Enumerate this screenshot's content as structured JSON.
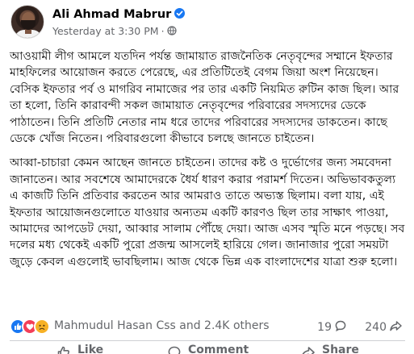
{
  "post": {
    "author": "Ali Ahmad Mabrur",
    "timestamp": "Yesterday at 3:30 PM",
    "paragraphs": [
      "আওয়ামী লীগ আমলে যতদিন পর্যন্ত জামায়াত রাজনৈতিক নেতৃবৃন্দের সম্মানে ইফতার মাহফিলের আয়োজন করতে পেরেছে, এর প্রতিটিতেই বেগম জিয়া অংশ নিয়েছেন। বেসিক ইফতার পর্ব ও মাগরিব নামাজের পর তার একটি নিয়মিত রুটিন কাজ ছিল। আর তা হলো, তিনি কারাবন্দী সকল জামায়াত নেতৃবৃন্দের পরিবারের সদস্যদের ডেকে পাঠাতেন। তিনি প্রতিটি নেতার নাম ধরে তাদের পরিবারের সদস্যদের ডাকতেন। কাছে ডেকে খোঁজ নিতেন। পরিবারগুলো কীভাবে চলছে জানতে চাইতেন।",
      "আব্বা-চাচারা কেমন আছেন জানতে চাইতেন। তাদের কষ্ট ও দুর্ভোগের জন্য সমবেদনা জানাতেন। আর সবশেষে আমাদেরকে ধৈর্য ধারণ করার পরামর্শ দিতেন। অভিভাবকতুল্য এ কাজটি তিনি প্রতিবার করতেন আর আমরাও তাতে অভ্যস্ত ছিলাম। বলা যায়, এই ইফতার আয়োজনগুলোতে যাওয়ার অন্যতম একটি কারণও ছিল তার সাক্ষাৎ পাওয়া, আমাদের আপডেট দেয়া, আব্বার সালাম পৌঁছে দেয়া। আজ এসব স্মৃতি মনে পড়ছে। সব দলের মধ্য থেকেই একটি পুরো প্রজন্ম আসলেই হারিয়ে গেল। জানাজার পুরো সময়টা জুড়ে কেবল এগুলোই ভাবছিলাম। আজ থেকে ভিন্ন এক বাংলাদেশের যাত্রা শুরু হলো।"
    ]
  },
  "stats": {
    "reactions_text": "Mahmudul Hasan Css and 2.4K others",
    "comments": "19",
    "shares": "240"
  },
  "actions": {
    "like": "Like",
    "comment": "Comment",
    "share": "Share"
  },
  "colors": {
    "accent": "#1877f2",
    "love": "#f33e58",
    "sad": "#f7b125",
    "secondary_text": "#65676b"
  },
  "icons": {
    "verified": "verified-badge-icon",
    "privacy": "globe-icon",
    "reactions": [
      "like-reaction-icon",
      "love-reaction-icon",
      "sad-reaction-icon"
    ]
  }
}
